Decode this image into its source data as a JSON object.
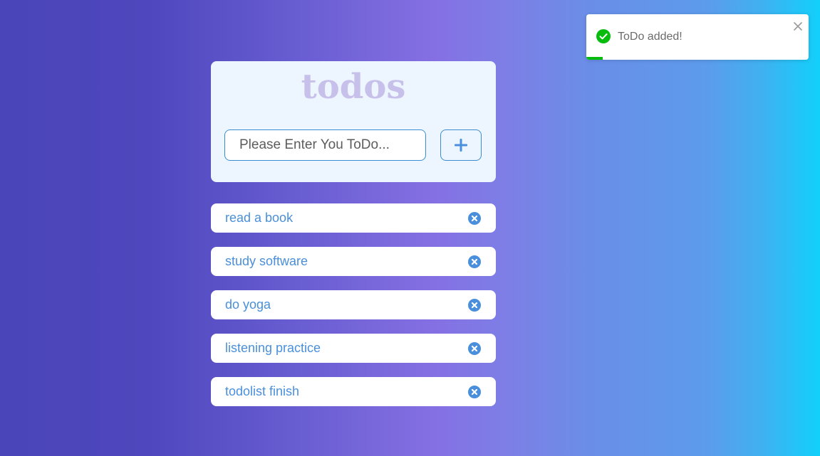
{
  "app": {
    "title": "todos"
  },
  "form": {
    "input_value": "",
    "input_placeholder": "Please Enter You ToDo...",
    "add_icon": "plus-icon"
  },
  "todos": [
    {
      "label": "read a book",
      "remove_icon": "close-circle-icon"
    },
    {
      "label": "study software",
      "remove_icon": "close-circle-icon"
    },
    {
      "label": "do yoga",
      "remove_icon": "close-circle-icon"
    },
    {
      "label": "listening practice",
      "remove_icon": "close-circle-icon"
    },
    {
      "label": "todolist finish",
      "remove_icon": "close-circle-icon"
    }
  ],
  "toast": {
    "message": "ToDo added!",
    "status_icon": "check-circle-icon",
    "close_icon": "close-icon",
    "progress": 0.075
  },
  "colors": {
    "card_background": "#edf5fe",
    "title": "#c7c0ea",
    "accent_blue": "#4a8fdc",
    "success_green": "#07bc0c"
  }
}
